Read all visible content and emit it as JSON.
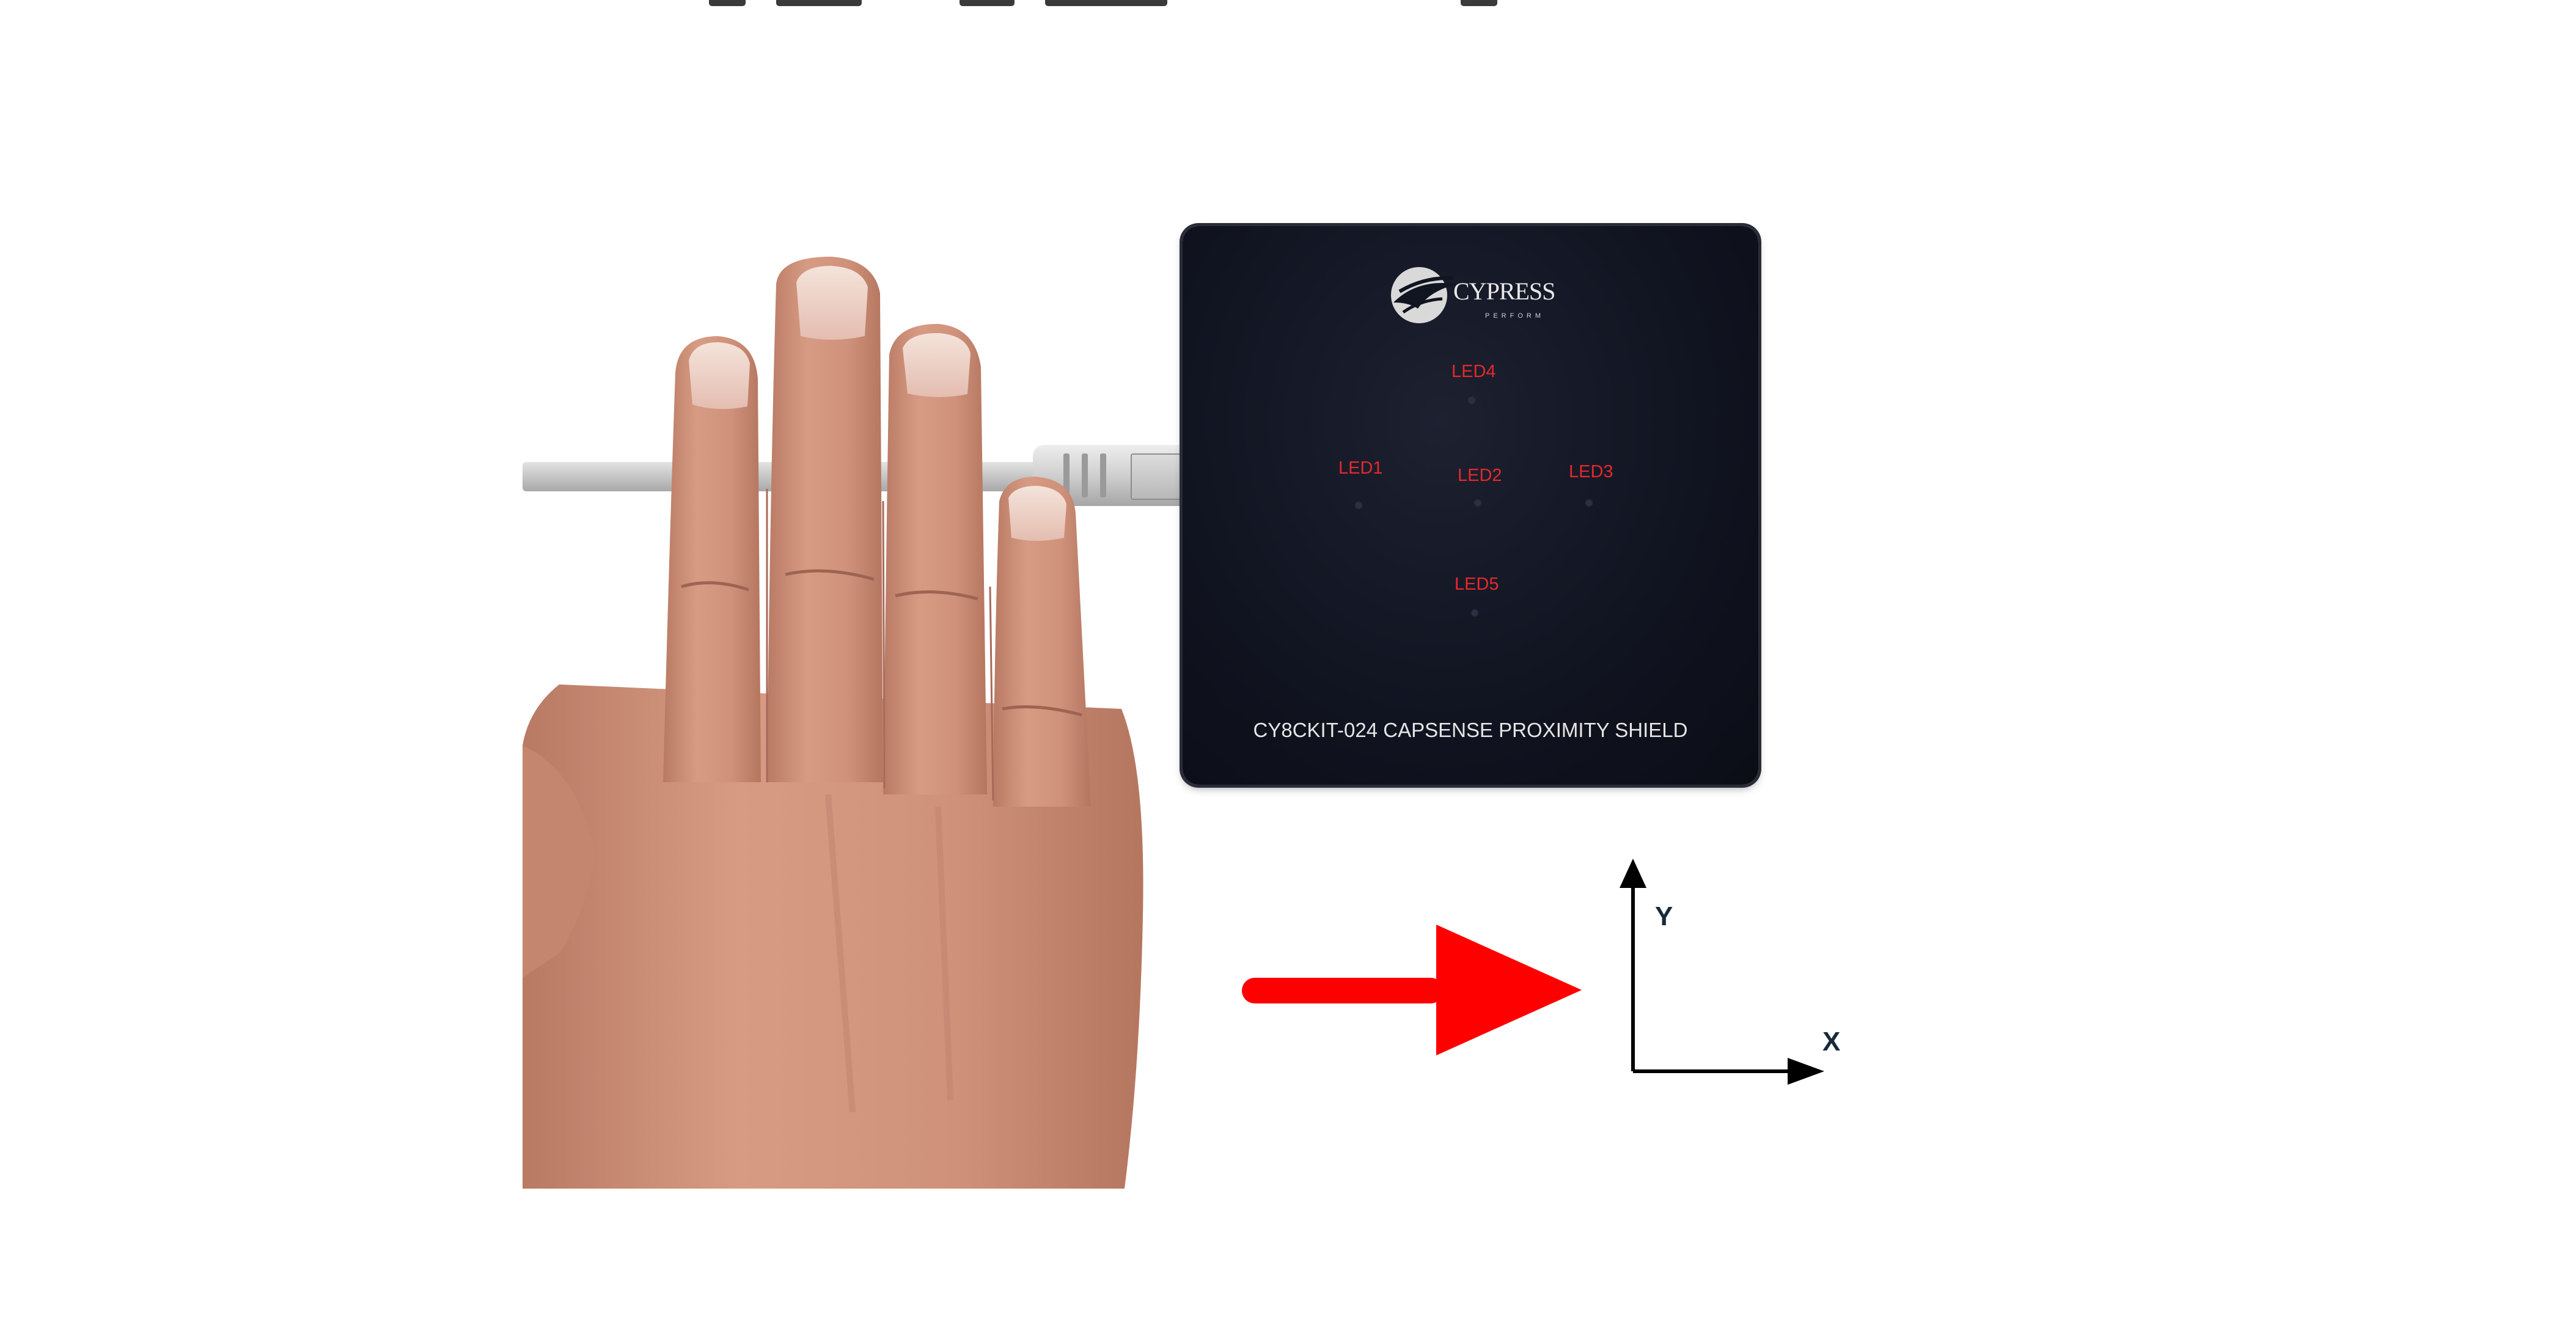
{
  "colors": {
    "led_label": "#e5282c",
    "arrow": "#ff0000",
    "board": "#111421",
    "axis": "#000000"
  },
  "board": {
    "logo_text": "CYPRESS",
    "logo_subtext": "PERFORM",
    "title": "CY8CKIT-024 CAPSENSE PROXIMITY SHIELD",
    "leds": [
      {
        "label": "LED4"
      },
      {
        "label": "LED1"
      },
      {
        "label": "LED2"
      },
      {
        "label": "LED3"
      },
      {
        "label": "LED5"
      }
    ]
  },
  "gesture": {
    "direction": "left-to-right",
    "arrow_icon": "right-arrow-icon"
  },
  "axes": {
    "y_label": "Y",
    "x_label": "X"
  }
}
